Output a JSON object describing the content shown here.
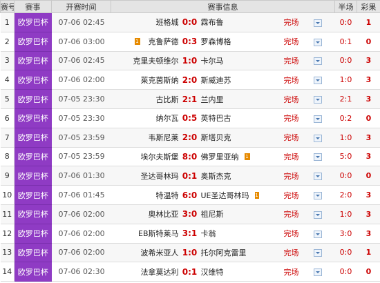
{
  "headers": [
    "赛号",
    "赛事",
    "开赛时间",
    "赛事信息",
    "半场",
    "彩果"
  ],
  "matches": [
    {
      "no": "1",
      "league": "欧罗巴杯",
      "time": "07-06 02:45",
      "home": "班格城",
      "home_flag": "",
      "score": "0:0",
      "away": "霖布鲁",
      "away_flag": "",
      "status": "完场",
      "half": "0:0",
      "result": "1"
    },
    {
      "no": "2",
      "league": "欧罗巴杯",
      "time": "07-06 03:00",
      "home": "克鲁萨德",
      "home_flag": "1",
      "score": "0:3",
      "away": "罗森博格",
      "away_flag": "",
      "status": "完场",
      "half": "0:1",
      "result": "0"
    },
    {
      "no": "3",
      "league": "欧罗巴杯",
      "time": "07-06 02:45",
      "home": "克里夫顿维尔",
      "home_flag": "",
      "score": "1:0",
      "away": "卡尔马",
      "away_flag": "",
      "status": "完场",
      "half": "0:0",
      "result": "3"
    },
    {
      "no": "4",
      "league": "欧罗巴杯",
      "time": "07-06 02:00",
      "home": "莱克茵斯纳",
      "home_flag": "",
      "score": "2:0",
      "away": "斯威迪苏",
      "away_flag": "",
      "status": "完场",
      "half": "1:0",
      "result": "3"
    },
    {
      "no": "5",
      "league": "欧罗巴杯",
      "time": "07-05 23:30",
      "home": "古比斯",
      "home_flag": "",
      "score": "2:1",
      "away": "兰内里",
      "away_flag": "",
      "status": "完场",
      "half": "2:1",
      "result": "3"
    },
    {
      "no": "6",
      "league": "欧罗巴杯",
      "time": "07-05 23:30",
      "home": "纳尔瓦",
      "home_flag": "",
      "score": "0:5",
      "away": "英特巴古",
      "away_flag": "",
      "status": "完场",
      "half": "0:2",
      "result": "0"
    },
    {
      "no": "7",
      "league": "欧罗巴杯",
      "time": "07-05 23:59",
      "home": "韦斯尼莱",
      "home_flag": "",
      "score": "2:0",
      "away": "斯塔贝克",
      "away_flag": "",
      "status": "完场",
      "half": "1:0",
      "result": "3"
    },
    {
      "no": "8",
      "league": "欧罗巴杯",
      "time": "07-05 23:59",
      "home": "埃尔夫斯堡",
      "home_flag": "",
      "score": "8:0",
      "away": "佛罗里亚纳",
      "away_flag": "1",
      "status": "完场",
      "half": "5:0",
      "result": "3"
    },
    {
      "no": "9",
      "league": "欧罗巴杯",
      "time": "07-06 01:30",
      "home": "圣达哥林玛",
      "home_flag": "",
      "score": "0:1",
      "away": "奥斯杰克",
      "away_flag": "",
      "status": "完场",
      "half": "0:0",
      "result": "0"
    },
    {
      "no": "10",
      "league": "欧罗巴杯",
      "time": "07-06 01:45",
      "home": "特温特",
      "home_flag": "",
      "score": "6:0",
      "away": "UE圣达哥林玛",
      "away_flag": "1",
      "status": "完场",
      "half": "2:0",
      "result": "3"
    },
    {
      "no": "11",
      "league": "欧罗巴杯",
      "time": "07-06 02:00",
      "home": "奥林比亚",
      "home_flag": "",
      "score": "3:0",
      "away": "祖尼斯",
      "away_flag": "",
      "status": "完场",
      "half": "1:0",
      "result": "3"
    },
    {
      "no": "12",
      "league": "欧罗巴杯",
      "time": "07-06 02:00",
      "home": "EB斯特莱马",
      "home_flag": "",
      "score": "3:1",
      "away": "卡翁",
      "away_flag": "",
      "status": "完场",
      "half": "3:0",
      "result": "3"
    },
    {
      "no": "13",
      "league": "欧罗巴杯",
      "time": "07-06 02:00",
      "home": "波希米亚人",
      "home_flag": "",
      "score": "1:0",
      "away": "托尔阿克雷里",
      "away_flag": "",
      "status": "完场",
      "half": "0:0",
      "result": "1"
    },
    {
      "no": "14",
      "league": "欧罗巴杯",
      "time": "07-06 02:30",
      "home": "法拿莫达利",
      "home_flag": "",
      "score": "0:1",
      "away": "汉维特",
      "away_flag": "",
      "status": "完场",
      "half": "0:0",
      "result": "0"
    }
  ]
}
